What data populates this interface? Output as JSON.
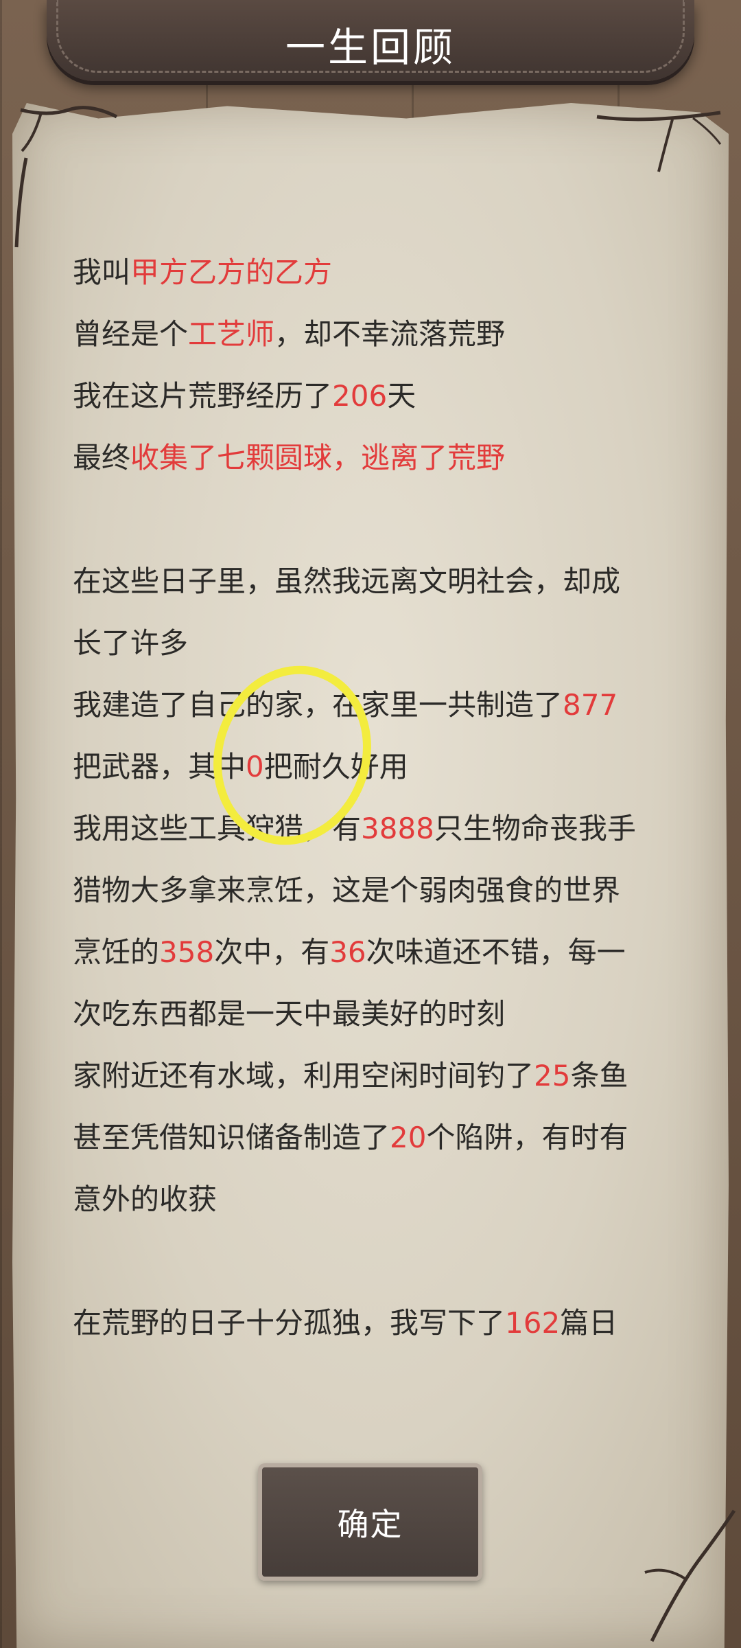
{
  "header": {
    "title": "一生回顾"
  },
  "story": {
    "p1": {
      "l1": {
        "a": "我叫",
        "name": "甲方乙方的乙方"
      },
      "l2": {
        "a": "曾经是个",
        "job": "工艺师",
        "b": "，却不幸流落荒野"
      },
      "l3": {
        "a": "我在这片荒野经历了",
        "days": "206",
        "b": "天"
      },
      "l4": {
        "a": "最终",
        "ending": "收集了七颗圆球，逃离了荒野"
      }
    },
    "p2": {
      "l1": "在这些日子里，虽然我远离文明社会，却成",
      "l2": "长了许多",
      "l3": {
        "a": "我建造了自己的家，在家里一共制造了",
        "weapons": "877"
      },
      "l4": {
        "a": "把武器，其中",
        "durable": "0",
        "b": "把耐久好用"
      },
      "l5": {
        "a": "我用这些工具狩猎，有",
        "kills": "3888",
        "b": "只生物命丧我手"
      },
      "l6": "猎物大多拿来烹饪，这是个弱肉强食的世界",
      "l7": {
        "a": "烹饪的",
        "cooks": "358",
        "b": "次中，有",
        "tasty": "36",
        "c": "次味道还不错，每一"
      },
      "l8": "次吃东西都是一天中最美好的时刻",
      "l9": {
        "a": "家附近还有水域，利用空闲时间钓了",
        "fish": "25",
        "b": "条鱼"
      },
      "l10": {
        "a": "甚至凭借知识储备制造了",
        "traps": "20",
        "b": "个陷阱，有时有"
      },
      "l11": "意外的收获"
    },
    "p3": {
      "l1": {
        "a": "在荒野的日子十分孤独，我写下了",
        "diaries": "162",
        "b": "篇日"
      }
    }
  },
  "confirm_label": "确定",
  "colors": {
    "highlight": "#e23b3b",
    "text": "#2b2a28",
    "annotation": "#f3ec3e"
  }
}
